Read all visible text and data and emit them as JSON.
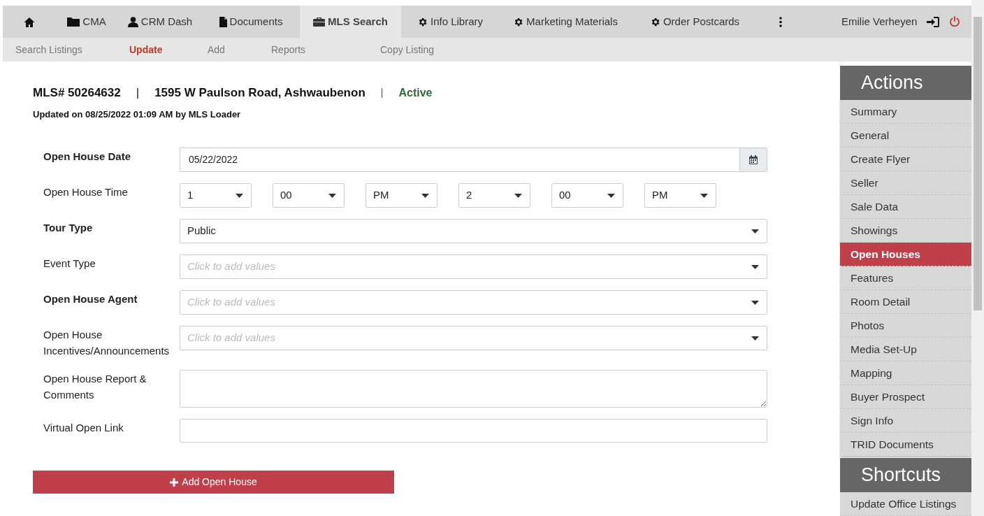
{
  "nav": {
    "items": [
      {
        "kind": "home",
        "selected": false
      },
      {
        "kind": "folder",
        "label": "CMA",
        "selected": false
      },
      {
        "kind": "person",
        "label": "CRM Dash",
        "selected": false
      },
      {
        "kind": "document",
        "label": "Documents",
        "selected": false
      },
      {
        "kind": "briefcase",
        "label": "MLS Search",
        "selected": true
      },
      {
        "kind": "gear",
        "label": "Info Library",
        "selected": false
      },
      {
        "kind": "gear",
        "label": "Marketing Materials",
        "selected": false
      },
      {
        "kind": "gear",
        "label": "Order Postcards",
        "selected": false
      },
      {
        "kind": "more",
        "selected": false
      }
    ],
    "user": "Emilie Verheyen"
  },
  "subnav": [
    {
      "label": "Search Listings",
      "selected": false
    },
    {
      "label": "Update",
      "selected": true
    },
    {
      "label": "Add",
      "selected": false
    },
    {
      "label": "Reports",
      "selected": false
    },
    {
      "label": "Copy Listing",
      "selected": false
    }
  ],
  "listing": {
    "mls": "MLS# 50264632",
    "separators": [
      "|",
      "|"
    ],
    "address": "1595 W Paulson Road, Ashwaubenon",
    "status": "Active",
    "updated": "Updated on 08/25/2022 01:09 AM by MLS Loader"
  },
  "form": [
    {
      "kind": "date",
      "label": "Open House Date",
      "required": true,
      "value": "05/22/2022"
    },
    {
      "kind": "times",
      "label": "Open House Time",
      "required": false,
      "values": [
        "1",
        "00",
        "PM",
        "2",
        "00",
        "PM"
      ]
    },
    {
      "kind": "select",
      "label": "Tour Type",
      "required": true,
      "value": "Public"
    },
    {
      "kind": "multi",
      "label": "Event Type",
      "required": false,
      "placeholder": "Click to add values"
    },
    {
      "kind": "multi",
      "label": "Open House Agent",
      "required": true,
      "placeholder": "Click to add values"
    },
    {
      "kind": "multi",
      "label": "Open House Incentives/Announcements",
      "required": false,
      "placeholder": "Click to add values"
    },
    {
      "kind": "textarea",
      "label": "Open House Report & Comments",
      "required": false
    },
    {
      "kind": "text",
      "label": "Virtual Open Link",
      "required": false
    }
  ],
  "add_button": "Add Open House",
  "actions": {
    "title": "Actions",
    "items": [
      {
        "label": "Summary",
        "selected": false
      },
      {
        "label": "General",
        "selected": false
      },
      {
        "label": "Create Flyer",
        "selected": false
      },
      {
        "label": "Seller",
        "selected": false
      },
      {
        "label": "Sale Data",
        "selected": false
      },
      {
        "label": "Showings",
        "selected": false
      },
      {
        "label": "Open Houses",
        "selected": true
      },
      {
        "label": "Features",
        "selected": false
      },
      {
        "label": "Room Detail",
        "selected": false
      },
      {
        "label": "Photos",
        "selected": false
      },
      {
        "label": "Media Set-Up",
        "selected": false
      },
      {
        "label": "Mapping",
        "selected": false
      },
      {
        "label": "Buyer Prospect",
        "selected": false
      },
      {
        "label": "Sign Info",
        "selected": false
      },
      {
        "label": "TRID Documents",
        "selected": false
      }
    ]
  },
  "shortcuts": {
    "title": "Shortcuts",
    "items": [
      {
        "label": "Update Office Listings"
      }
    ]
  }
}
